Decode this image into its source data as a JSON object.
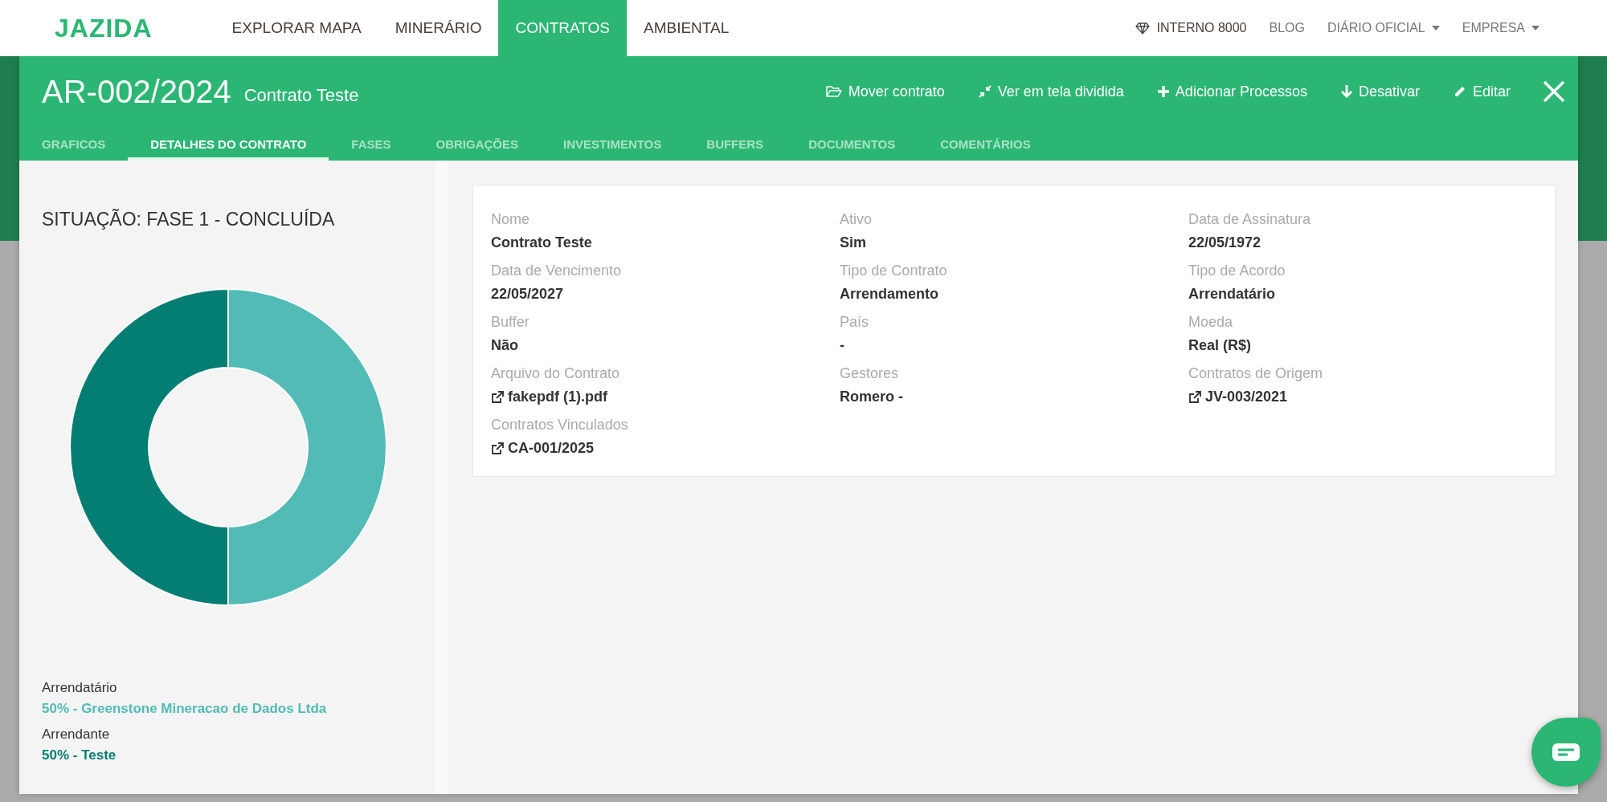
{
  "logo": "JAZIDA",
  "nav": {
    "items": [
      {
        "label": "EXPLORAR MAPA",
        "selected": false
      },
      {
        "label": "MINERÁRIO",
        "selected": false
      },
      {
        "label": "CONTRATOS",
        "selected": true
      },
      {
        "label": "AMBIENTAL",
        "selected": false
      }
    ],
    "right": [
      {
        "kind": "plan",
        "label": "INTERNO 8000"
      },
      {
        "kind": "link",
        "label": "BLOG"
      },
      {
        "kind": "dropdown",
        "label": "DIÁRIO OFICIAL"
      },
      {
        "kind": "dropdown",
        "label": "EMPRESA"
      }
    ]
  },
  "contract": {
    "code": "AR-002/2024",
    "name": "Contrato Teste",
    "actions": [
      {
        "kind": "move",
        "label": "Mover contrato"
      },
      {
        "kind": "split",
        "label": "Ver em tela dividida"
      },
      {
        "kind": "add",
        "label": "Adicionar Processos"
      },
      {
        "kind": "deactivate",
        "label": "Desativar"
      },
      {
        "kind": "edit",
        "label": "Editar"
      }
    ],
    "tabs": [
      {
        "label": "GRAFICOS",
        "selected": false
      },
      {
        "label": "DETALHES DO CONTRATO",
        "selected": true
      },
      {
        "label": "FASES",
        "selected": false
      },
      {
        "label": "OBRIGAÇÕES",
        "selected": false
      },
      {
        "label": "INVESTIMENTOS",
        "selected": false
      },
      {
        "label": "BUFFERS",
        "selected": false
      },
      {
        "label": "DOCUMENTOS",
        "selected": false
      },
      {
        "label": "COMENTÁRIOS",
        "selected": false
      }
    ]
  },
  "status_panel": {
    "title": "SITUAÇÃO: FASE 1 - CONCLUÍDA",
    "chart_data": {
      "type": "donut",
      "categories": [
        "50% - Greenstone Mineracao de Dados Ltda",
        "50% - Teste"
      ],
      "values": [
        50,
        50
      ]
    },
    "legend": [
      {
        "role": "Arrendatário",
        "color": "#52bbb5"
      },
      {
        "role": "Arrendante",
        "color": "#047e72"
      }
    ]
  },
  "details": {
    "fields": [
      {
        "kind": "text",
        "label": "Nome",
        "value": "Contrato Teste"
      },
      {
        "kind": "text",
        "label": "Ativo",
        "value": "Sim"
      },
      {
        "kind": "text",
        "label": "Data de Assinatura",
        "value": "22/05/1972"
      },
      {
        "kind": "text",
        "label": "Data de Vencimento",
        "value": "22/05/2027"
      },
      {
        "kind": "text",
        "label": "Tipo de Contrato",
        "value": "Arrendamento"
      },
      {
        "kind": "text",
        "label": "Tipo de Acordo",
        "value": "Arrendatário"
      },
      {
        "kind": "text",
        "label": "Buffer",
        "value": "Não"
      },
      {
        "kind": "text",
        "label": "País",
        "value": "-"
      },
      {
        "kind": "text",
        "label": "Moeda",
        "value": "Real (R$)"
      },
      {
        "kind": "link",
        "label": "Arquivo do Contrato",
        "value": "fakepdf (1).pdf"
      },
      {
        "kind": "text",
        "label": "Gestores",
        "value": "Romero -"
      },
      {
        "kind": "link",
        "label": "Contratos de Origem",
        "value": "JV-003/2021"
      },
      {
        "kind": "link",
        "label": "Contratos Vinculados",
        "value": "CA-001/2025"
      }
    ]
  }
}
